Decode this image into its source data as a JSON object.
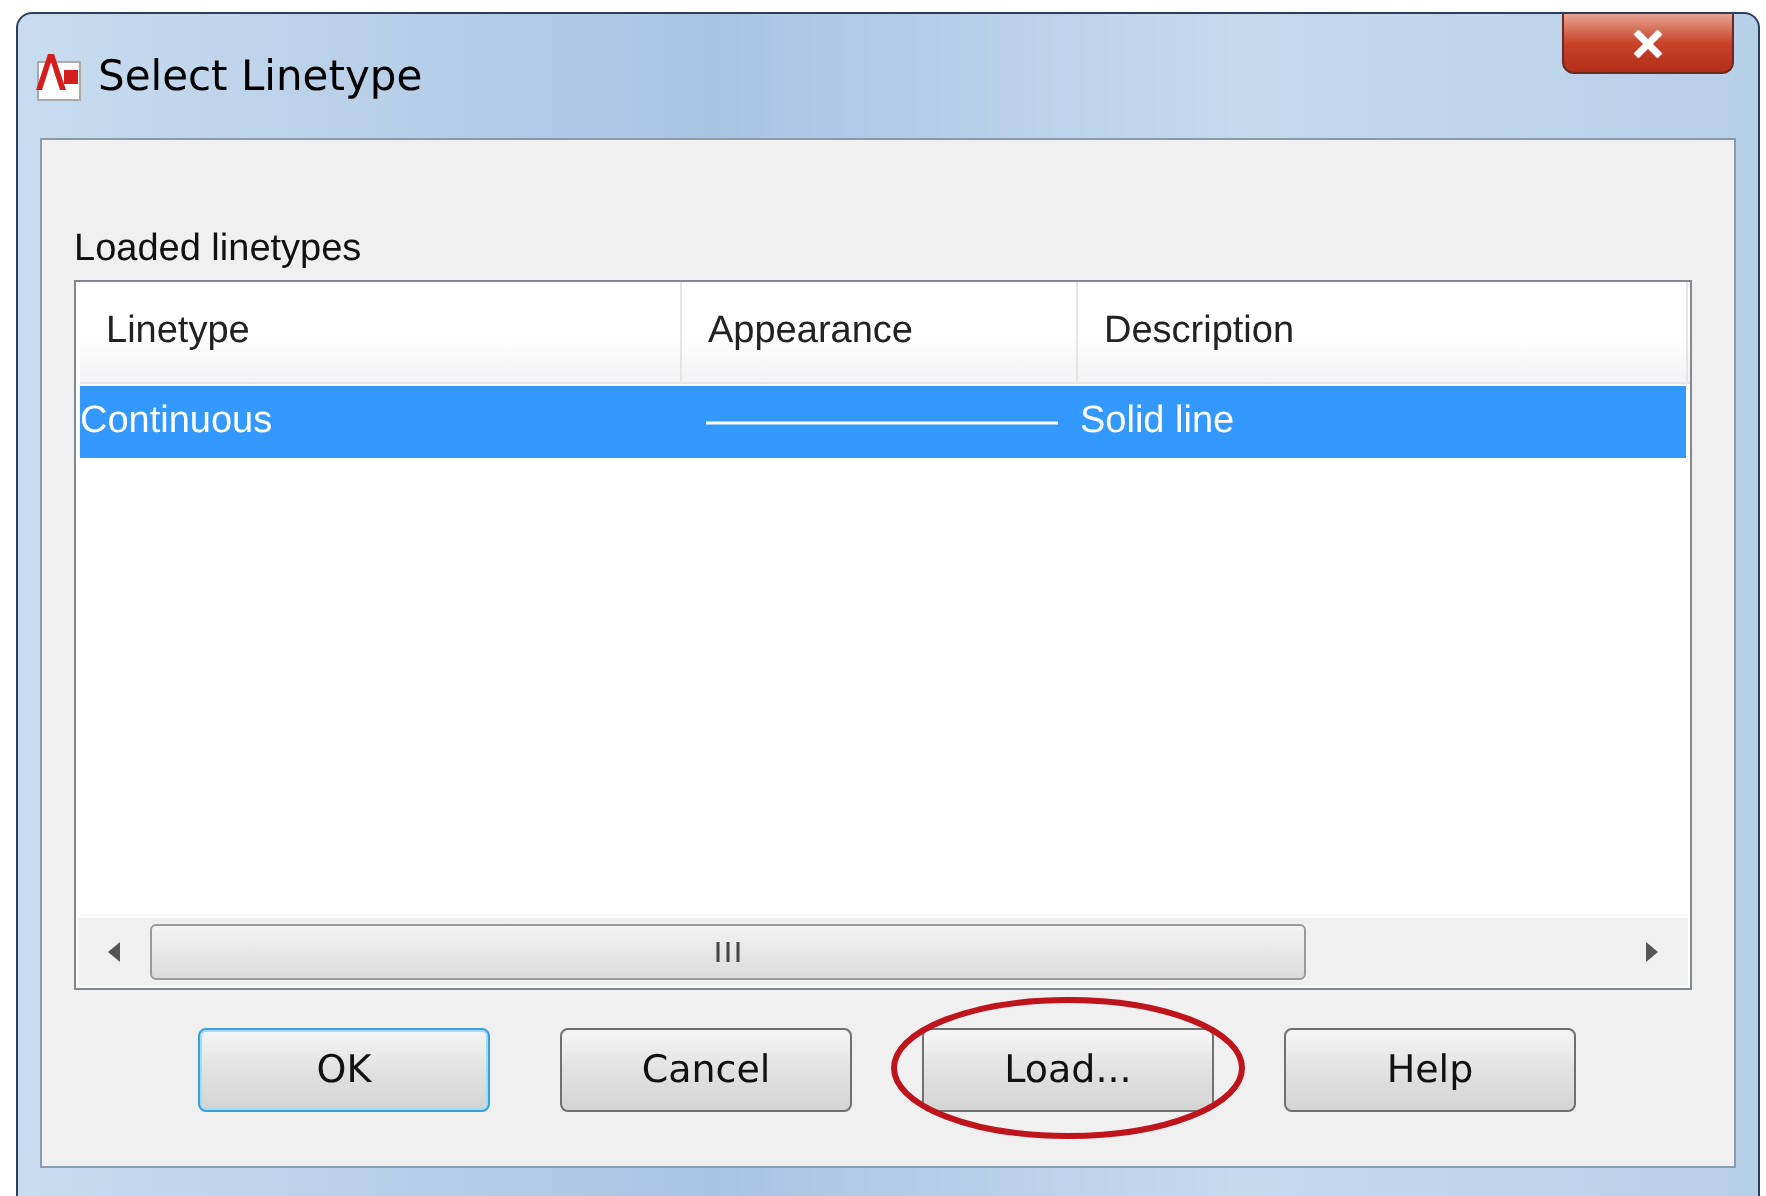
{
  "window": {
    "title": "Select Linetype"
  },
  "list_label": "Loaded linetypes",
  "table": {
    "columns": [
      "Linetype",
      "Appearance",
      "Description"
    ],
    "rows": [
      {
        "linetype": "Continuous",
        "kind": "solid",
        "description": "Solid line",
        "selected": true
      }
    ]
  },
  "buttons": [
    {
      "label": "OK",
      "default": true,
      "circled": false
    },
    {
      "label": "Cancel",
      "default": false,
      "circled": false
    },
    {
      "label": "Load...",
      "default": false,
      "circled": true
    },
    {
      "label": "Help",
      "default": false,
      "circled": false
    }
  ]
}
